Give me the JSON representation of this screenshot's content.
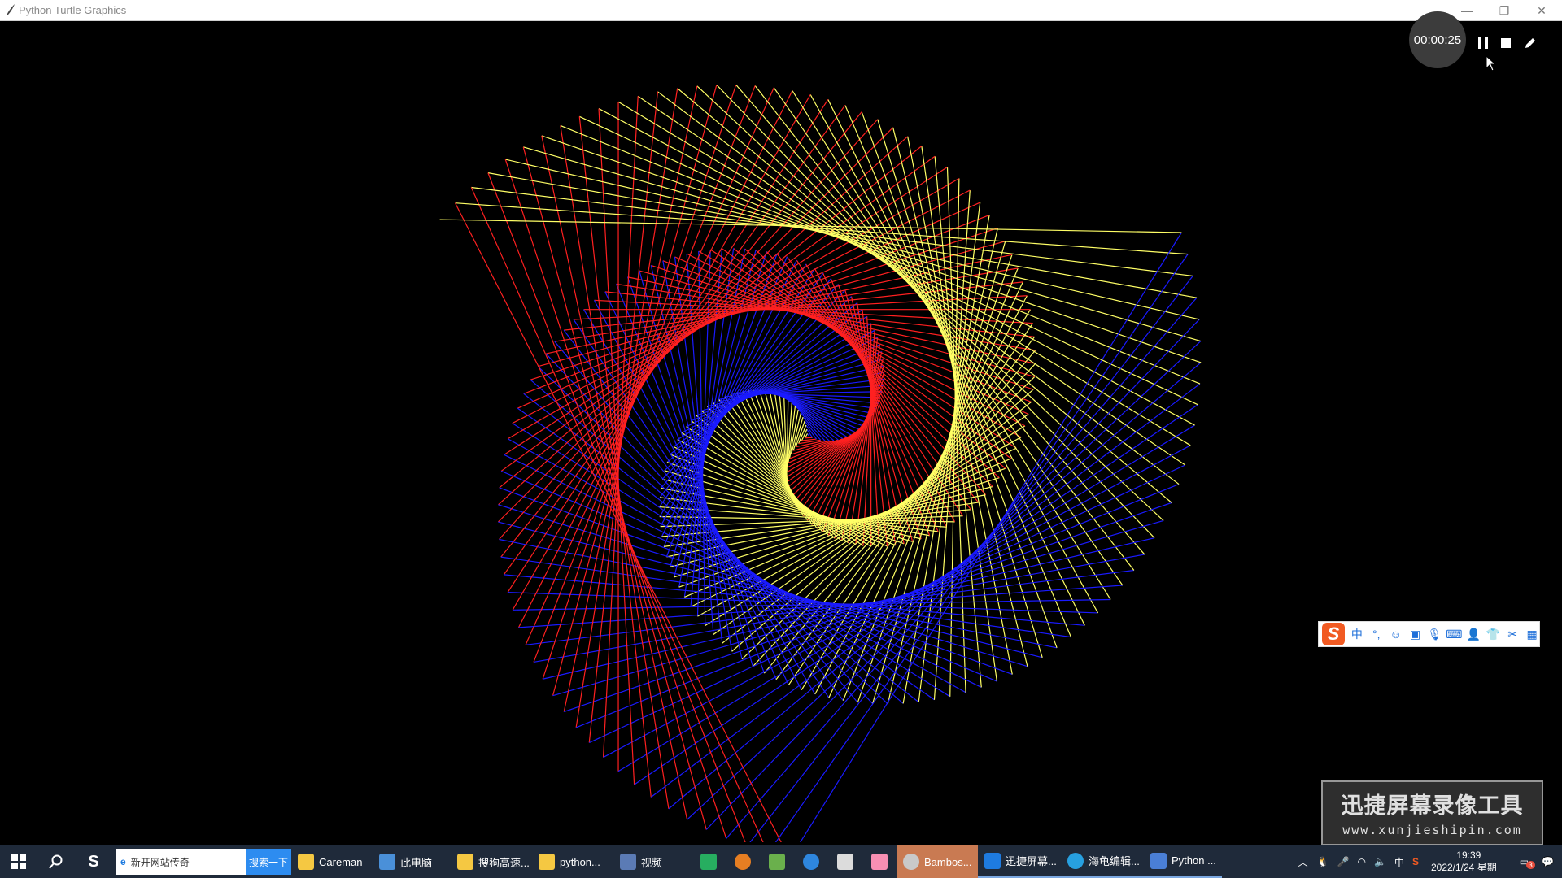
{
  "window": {
    "title": "Python Turtle Graphics"
  },
  "recorder": {
    "timer": "00:00:25"
  },
  "watermark": {
    "line1": "迅捷屏幕录像工具",
    "line2": "www.xunjieshipin.com"
  },
  "taskbar": {
    "search_value": "新开网站传奇",
    "search_button": "搜索一下",
    "items": [
      {
        "label": "Careman",
        "color": "#f5c842"
      },
      {
        "label": "此电脑",
        "color": "#4a90d9"
      },
      {
        "label": "搜狗高速...",
        "color": "#f5c842"
      },
      {
        "label": "python...",
        "color": "#f5c842"
      },
      {
        "label": "视频",
        "color": "#5b7bb5"
      },
      {
        "label": "Bambos...",
        "color": "#c9c9c9"
      },
      {
        "label": "迅捷屏幕...",
        "color": "#1e7be0"
      },
      {
        "label": "海龟编辑...",
        "color": "#27a0e0"
      },
      {
        "label": "Python ...",
        "color": "#4a7fd6"
      }
    ],
    "clock_time": "19:39",
    "clock_date": "2022/1/24 星期一",
    "ime_lang": "中",
    "notif_count": "3"
  },
  "ime_toolbar": {
    "mode": "中",
    "logo": "S"
  },
  "colors": {
    "spiral": [
      "#ff2020",
      "#1a1aff",
      "#ffff66"
    ]
  }
}
